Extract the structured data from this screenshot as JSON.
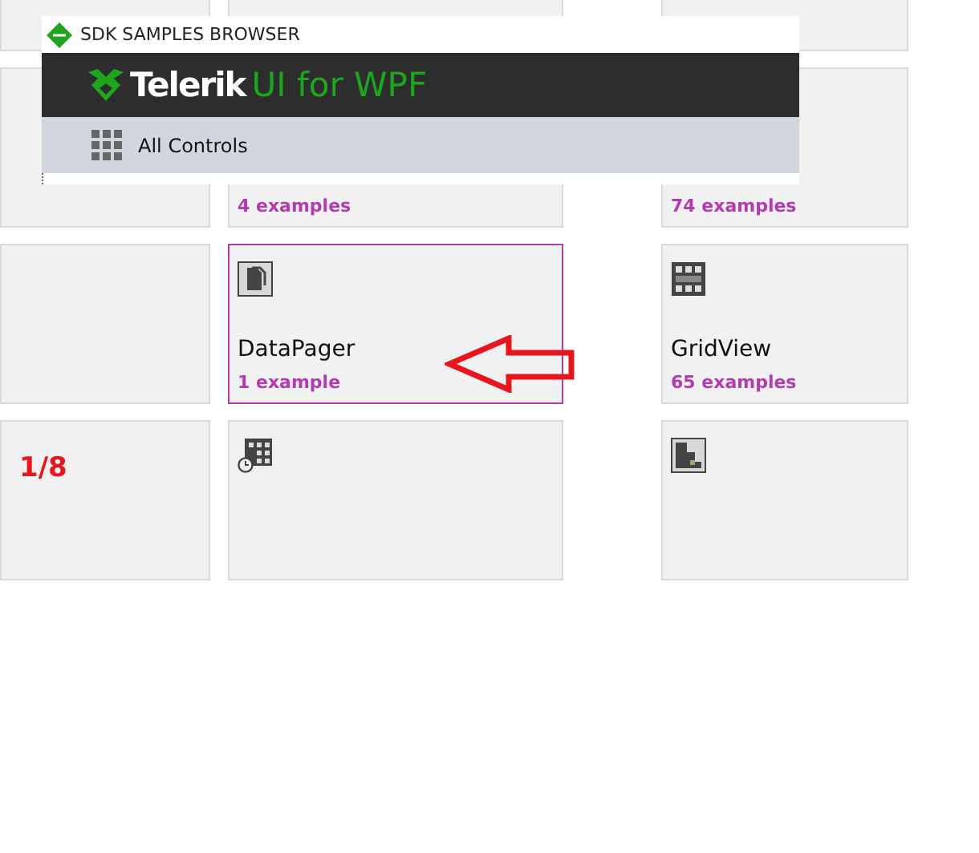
{
  "tiles": [
    {
      "selected": false
    },
    {
      "selected": false
    },
    {
      "selected": false
    },
    {
      "selected": false
    },
    {
      "count": "4 examples",
      "selected": false
    },
    {
      "count": "74 examples",
      "selected": false
    },
    {
      "selected": false
    },
    {
      "title": "DataPager",
      "count": "1 example",
      "selected": true
    },
    {
      "title": "GridView",
      "count": "65 examples",
      "selected": false
    },
    {
      "note": "1/8",
      "selected": false
    },
    {
      "selected": false
    },
    {
      "selected": false
    }
  ],
  "window": {
    "title": "SDK SAMPLES BROWSER",
    "brand": "Telerik",
    "product": "UI for WPF",
    "nav": "All Controls"
  }
}
